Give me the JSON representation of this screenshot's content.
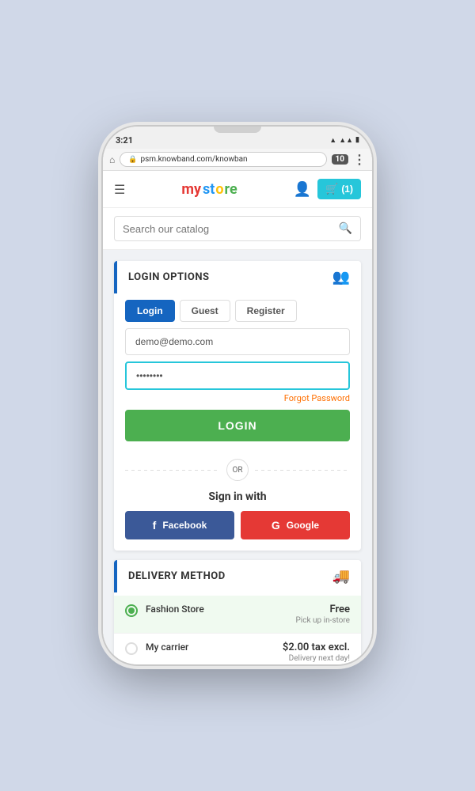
{
  "phone": {
    "status_time": "3:21",
    "browser_url": "psm.knowband.com/knowban",
    "tab_count": "10"
  },
  "header": {
    "logo_parts": [
      "my",
      " ",
      "st",
      "o",
      "re"
    ],
    "cart_label": "(1)",
    "hamburger_label": "☰"
  },
  "search": {
    "placeholder": "Search our catalog"
  },
  "login_card": {
    "header_title": "LOGIN OPTIONS",
    "tabs": [
      {
        "label": "Login",
        "active": true
      },
      {
        "label": "Guest",
        "active": false
      },
      {
        "label": "Register",
        "active": false
      }
    ],
    "email_value": "demo@demo.com",
    "password_value": "••••••••",
    "forgot_password_label": "Forgot Password",
    "login_button_label": "LOGIN",
    "or_label": "OR",
    "sign_in_with_label": "Sign in with",
    "facebook_label": "Facebook",
    "google_label": "Google"
  },
  "delivery_card": {
    "header_title": "DELIVERY METHOD",
    "options": [
      {
        "name": "Fashion Store",
        "price": "Free",
        "sub": "Pick up in-store",
        "selected": true
      },
      {
        "name": "My carrier",
        "price": "$2.00 tax excl.",
        "sub": "Delivery next day!",
        "selected": false
      }
    ]
  },
  "icons": {
    "hamburger": "☰",
    "user": "👤",
    "cart": "🛒",
    "search": "🔍",
    "lock": "🔒",
    "login_options_icon": "👥",
    "delivery_icon": "🚚"
  }
}
